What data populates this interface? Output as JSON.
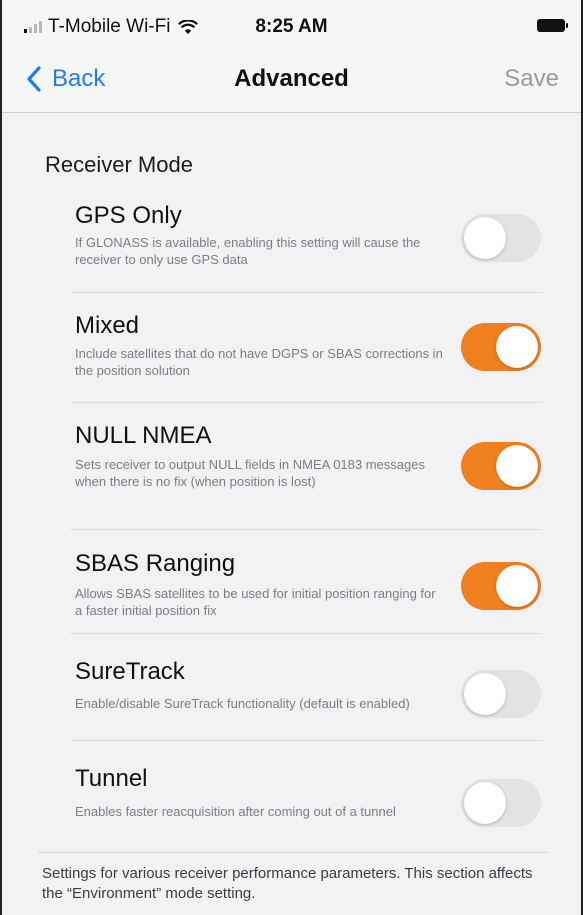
{
  "status_bar": {
    "carrier": "T-Mobile Wi-Fi",
    "time": "8:25 AM",
    "signal_icon": "signal-bars-icon",
    "wifi_icon": "wifi-icon",
    "battery_icon": "battery-icon"
  },
  "nav": {
    "back_label": "Back",
    "title": "Advanced",
    "save_label": "Save",
    "back_icon": "chevron-left-icon"
  },
  "section": {
    "header": "Receiver Mode",
    "items": [
      {
        "title": "GPS Only",
        "description": "If GLONASS is available, enabling this setting will cause the receiver to only use GPS data",
        "enabled": false
      },
      {
        "title": "Mixed",
        "description": "Include satellites that do not have DGPS or SBAS corrections in the position solution",
        "enabled": true
      },
      {
        "title": "NULL NMEA",
        "description": "Sets receiver to output NULL fields in NMEA 0183 messages when there is no fix (when position is lost)",
        "enabled": true
      },
      {
        "title": "SBAS Ranging",
        "description": "Allows SBAS satellites to be used for initial position ranging for a faster initial position fix",
        "enabled": true
      },
      {
        "title": "SureTrack",
        "description": "Enable/disable SureTrack functionality (default is enabled)",
        "enabled": false
      },
      {
        "title": "Tunnel",
        "description": "Enables faster reacquisition after coming out of a tunnel",
        "enabled": false
      }
    ],
    "footer": "Settings for various receiver performance parameters.  This section affects the “Environment” mode setting."
  },
  "colors": {
    "accent": "#1e7cf2",
    "toggle_on": "#f07f1e",
    "toggle_off": "#e3e3e6"
  }
}
